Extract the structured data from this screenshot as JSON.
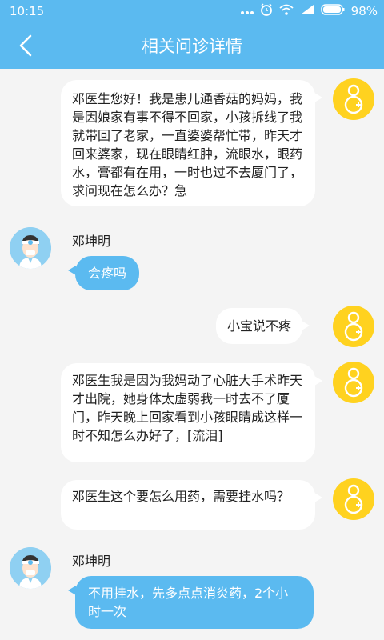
{
  "status_bar": {
    "time": "10:15",
    "battery": "98%",
    "icons": [
      "more-icon",
      "alarm-icon",
      "wifi-icon",
      "signal-icon",
      "battery-icon"
    ]
  },
  "header": {
    "title": "相关问诊详情",
    "back_icon": "back-arrow-icon"
  },
  "colors": {
    "primary": "#5bbaf0",
    "user_avatar": "#ffd21f",
    "background": "#f4f4f4"
  },
  "messages": [
    {
      "sender": "user",
      "text": "邓医生您好！我是患儿通香菇的妈妈，我是因娘家有事不得不回家，小孩拆线了我就带回了老家，一直婆婆帮忙带，昨天才回来婆家，现在眼睛红肿，流眼水，眼药水，膏都有在用，一时也过不去厦门了，求问现在怎么办？急"
    },
    {
      "sender": "doctor",
      "name": "邓坤明",
      "text": "会疼吗"
    },
    {
      "sender": "user",
      "text": "小宝说不疼"
    },
    {
      "sender": "user",
      "text": "邓医生我是因为我妈动了心脏大手术昨天才出院，她身体太虚弱我一时去不了厦门，昨天晚上回家看到小孩眼睛成这样一时不知怎么办好了，[流泪]"
    },
    {
      "sender": "user",
      "text": "邓医生这个要怎么用药，需要挂水吗？"
    },
    {
      "sender": "doctor",
      "name": "邓坤明",
      "text": "不用挂水，先多点点消炎药，2个小时一次"
    }
  ]
}
